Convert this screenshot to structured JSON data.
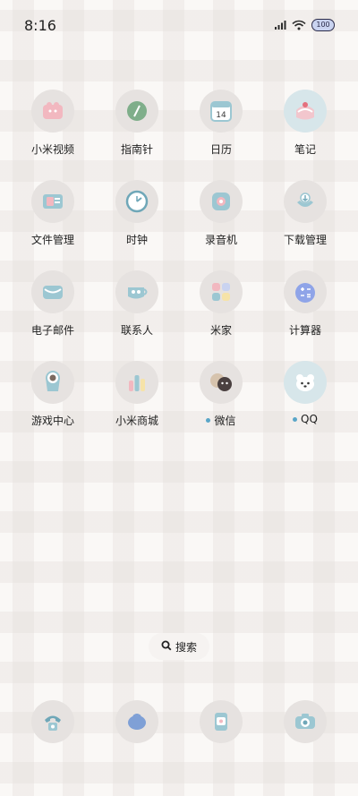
{
  "status": {
    "time": "8:16",
    "battery": "100"
  },
  "apps": [
    {
      "label": "小米视频",
      "icon": "video-icon",
      "dot": false
    },
    {
      "label": "指南针",
      "icon": "compass-icon",
      "dot": false
    },
    {
      "label": "日历",
      "icon": "calendar-icon",
      "dot": false,
      "calendar_day": "14"
    },
    {
      "label": "笔记",
      "icon": "notes-icon",
      "dot": false
    },
    {
      "label": "文件管理",
      "icon": "files-icon",
      "dot": false
    },
    {
      "label": "时钟",
      "icon": "clock-icon",
      "dot": false
    },
    {
      "label": "录音机",
      "icon": "recorder-icon",
      "dot": false
    },
    {
      "label": "下载管理",
      "icon": "download-icon",
      "dot": false
    },
    {
      "label": "电子邮件",
      "icon": "mail-icon",
      "dot": false
    },
    {
      "label": "联系人",
      "icon": "contacts-icon",
      "dot": false
    },
    {
      "label": "米家",
      "icon": "mijia-icon",
      "dot": false
    },
    {
      "label": "计算器",
      "icon": "calculator-icon",
      "dot": false
    },
    {
      "label": "游戏中心",
      "icon": "game-center-icon",
      "dot": false
    },
    {
      "label": "小米商城",
      "icon": "mi-store-icon",
      "dot": false
    },
    {
      "label": "微信",
      "icon": "wechat-icon",
      "dot": true
    },
    {
      "label": "QQ",
      "icon": "qq-icon",
      "dot": true
    }
  ],
  "search": {
    "label": "搜索",
    "icon": "search-icon"
  },
  "dock": [
    {
      "icon": "phone-icon"
    },
    {
      "icon": "messages-icon"
    },
    {
      "icon": "browser-icon"
    },
    {
      "icon": "camera-icon"
    }
  ],
  "colors": {
    "accent_blue": "#5aa6c8",
    "icon_pink": "#f2b8c0",
    "icon_teal": "#9cc7d2",
    "icon_gray": "#e6e2e0"
  }
}
